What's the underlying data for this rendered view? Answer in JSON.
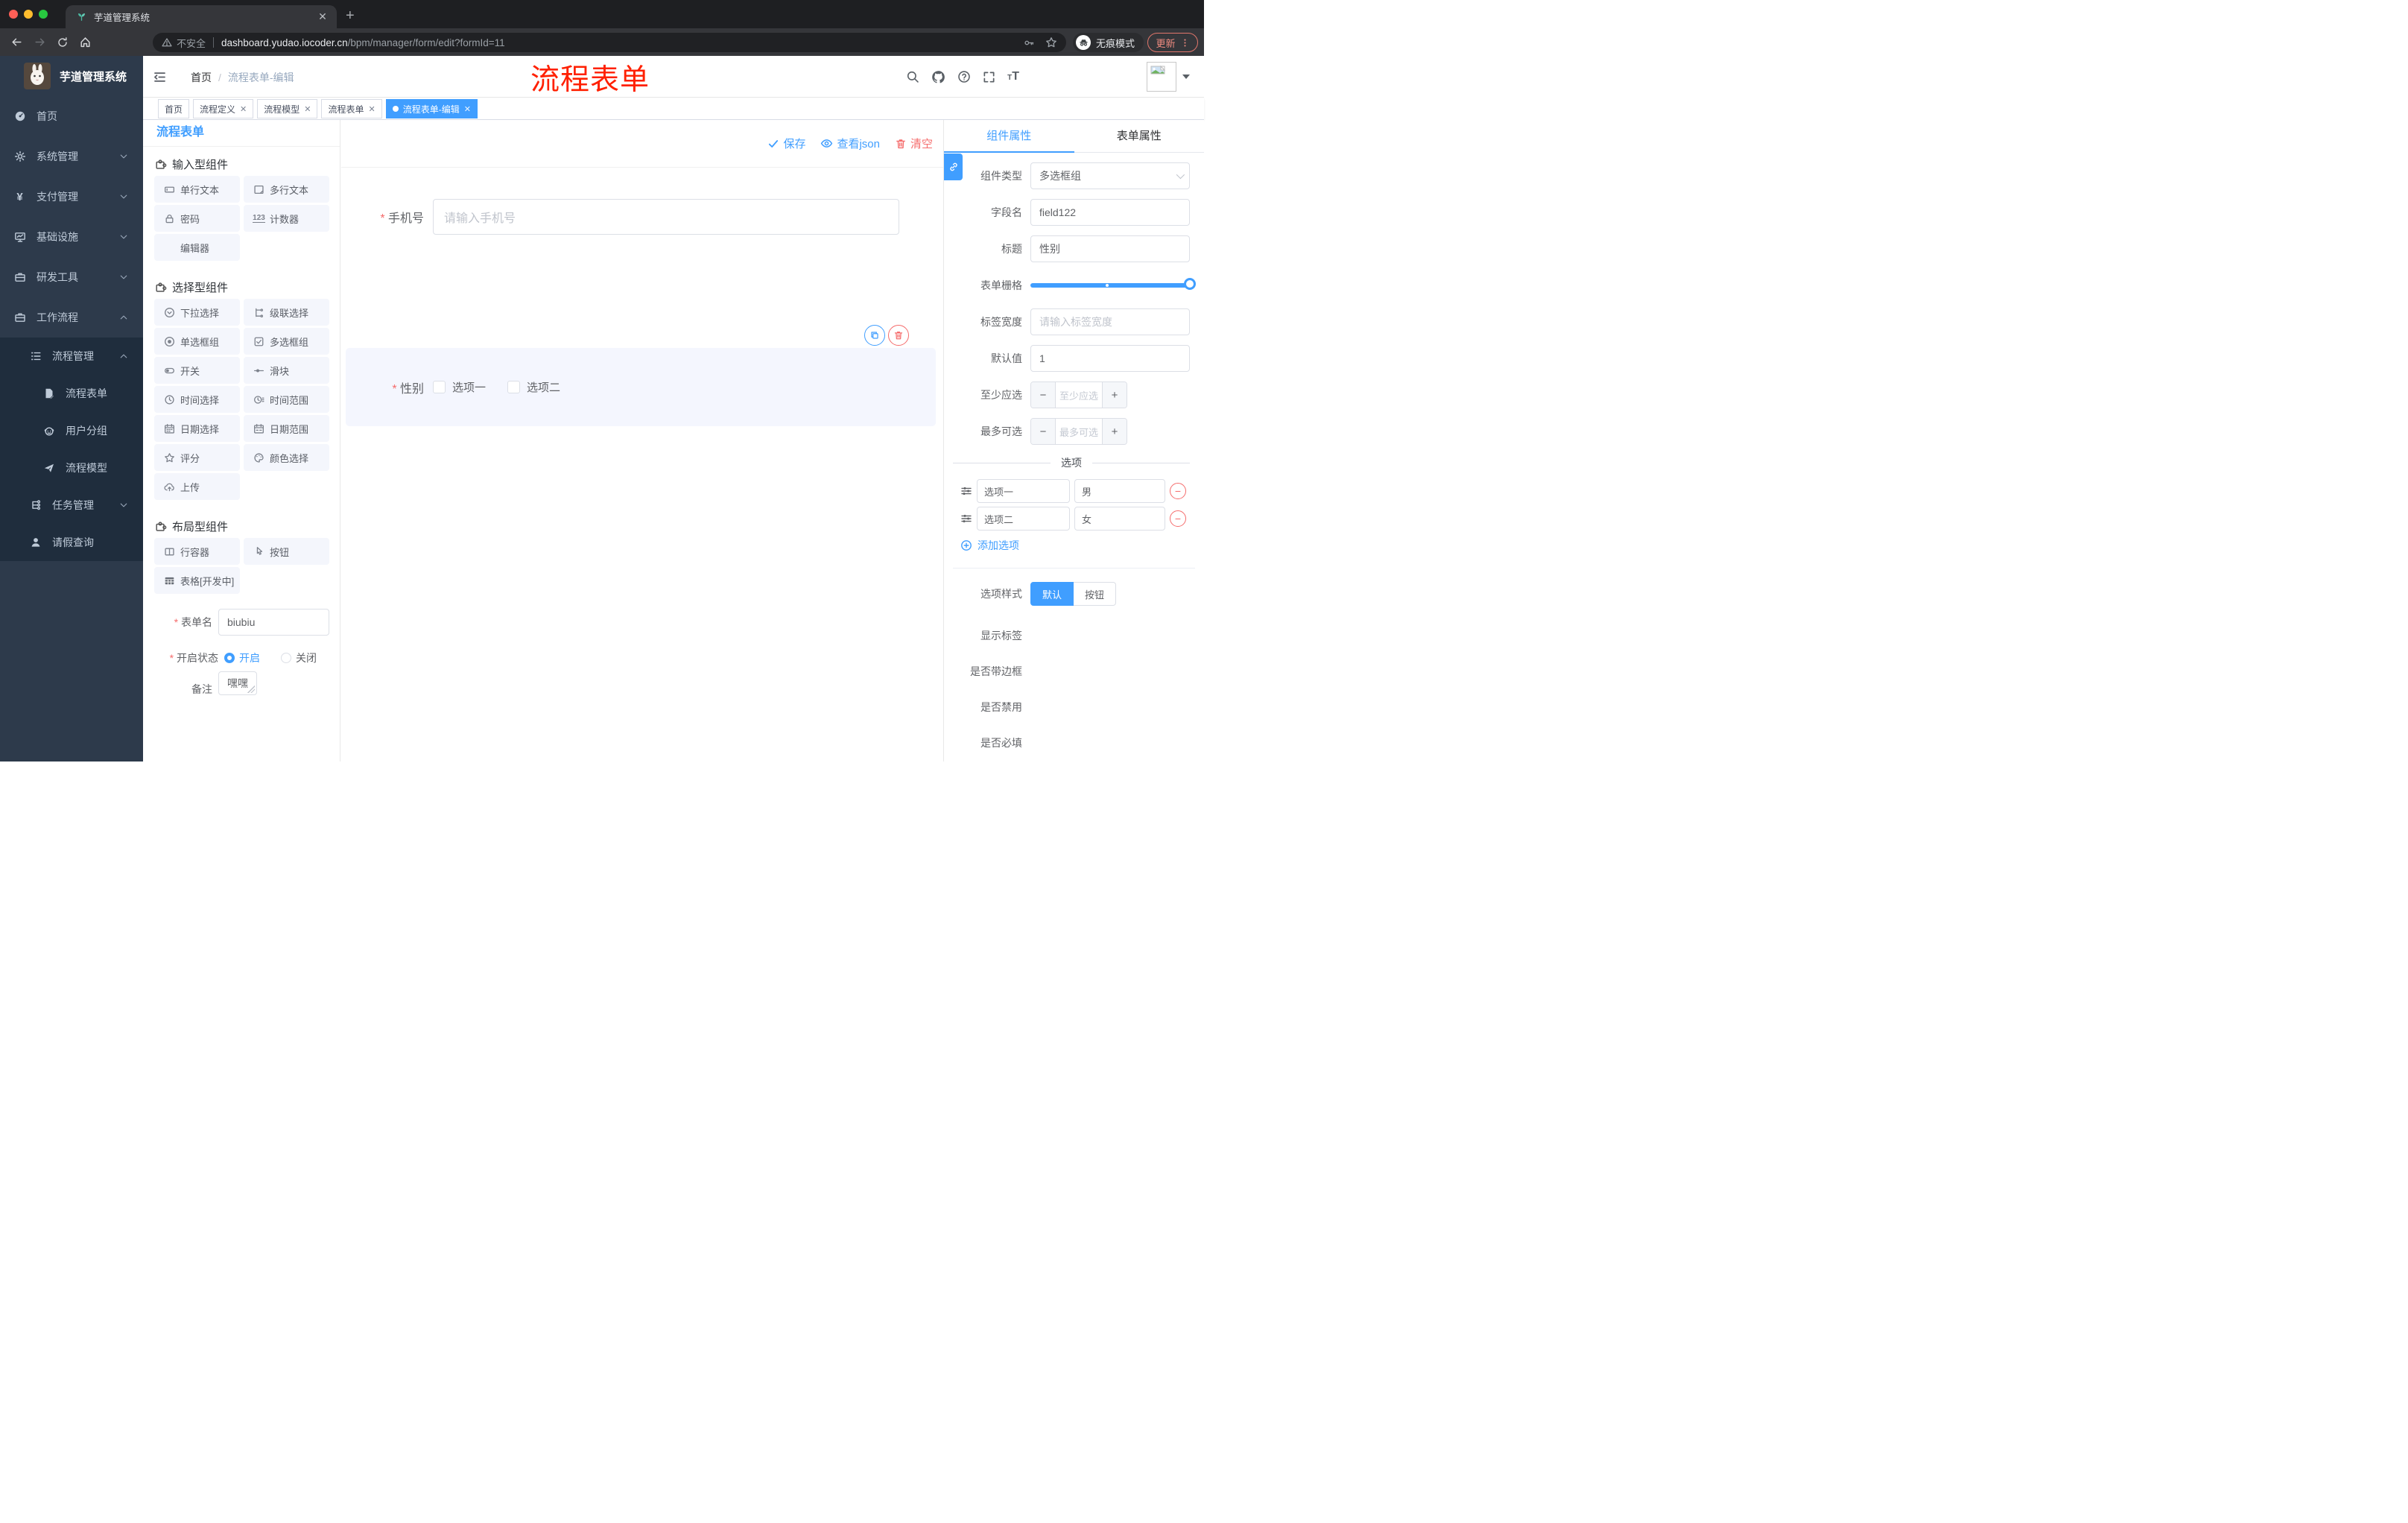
{
  "colors": {
    "accent": "#409eff",
    "danger": "#f56c6c",
    "annotation_red": "#ff2000",
    "sidebar_bg": "#2d3a4b",
    "submenu_bg": "#1f2d3d",
    "chip_bg": "#f4f6fc",
    "selected_bg": "#f4f6fe"
  },
  "browser": {
    "tab_title": "芋道管理系统",
    "tab_close": "✕",
    "not_secure": "不安全",
    "url_host": "dashboard.yudao.iocoder.cn",
    "url_path": "/bpm/manager/form/edit?formId=11",
    "incognito_label": "无痕模式",
    "update_label": "更新"
  },
  "sidebar": {
    "logo_title": "芋道管理系统",
    "items": [
      {
        "label": "首页",
        "icon": "dashboard",
        "level": 0,
        "chevron": "",
        "dark": false
      },
      {
        "label": "系统管理",
        "icon": "gear",
        "level": 0,
        "chevron": "down",
        "dark": false
      },
      {
        "label": "支付管理",
        "icon": "yen",
        "level": 0,
        "chevron": "down",
        "dark": false
      },
      {
        "label": "基础设施",
        "icon": "monitor",
        "level": 0,
        "chevron": "down",
        "dark": false
      },
      {
        "label": "研发工具",
        "icon": "briefcase",
        "level": 0,
        "chevron": "down",
        "dark": false
      },
      {
        "label": "工作流程",
        "icon": "briefcase",
        "level": 0,
        "chevron": "up",
        "dark": false
      },
      {
        "label": "流程管理",
        "icon": "flow-list",
        "level": 1,
        "chevron": "up",
        "dark": true
      },
      {
        "label": "流程表单",
        "icon": "doc-edit",
        "level": 2,
        "chevron": "",
        "dark": true
      },
      {
        "label": "用户分组",
        "icon": "robot",
        "level": 2,
        "chevron": "",
        "dark": true
      },
      {
        "label": "流程模型",
        "icon": "paper-plane",
        "level": 2,
        "chevron": "",
        "dark": true
      },
      {
        "label": "任务管理",
        "icon": "org-tree",
        "level": 1,
        "chevron": "down",
        "dark": true
      },
      {
        "label": "请假查询",
        "icon": "user",
        "level": 1,
        "chevron": "",
        "dark": true
      }
    ]
  },
  "header": {
    "breadcrumb_home": "首页",
    "breadcrumb_sep": "/",
    "breadcrumb_current": "流程表单-编辑",
    "annotation": "流程表单"
  },
  "tags": [
    {
      "label": "首页",
      "closable": false,
      "active": false
    },
    {
      "label": "流程定义",
      "closable": true,
      "active": false
    },
    {
      "label": "流程模型",
      "closable": true,
      "active": false
    },
    {
      "label": "流程表单",
      "closable": true,
      "active": false
    },
    {
      "label": "流程表单-编辑",
      "closable": true,
      "active": true
    }
  ],
  "left_panel": {
    "title": "流程表单",
    "sections": [
      {
        "title": "输入型组件",
        "items": [
          {
            "label": "单行文本",
            "icon": "text-field"
          },
          {
            "label": "多行文本",
            "icon": "textarea"
          },
          {
            "label": "密码",
            "icon": "lock"
          },
          {
            "label": "计数器",
            "icon": "counter"
          },
          {
            "label": "编辑器",
            "icon": "none"
          }
        ]
      },
      {
        "title": "选择型组件",
        "items": [
          {
            "label": "下拉选择",
            "icon": "select"
          },
          {
            "label": "级联选择",
            "icon": "cascade"
          },
          {
            "label": "单选框组",
            "icon": "radio"
          },
          {
            "label": "多选框组",
            "icon": "checkbox"
          },
          {
            "label": "开关",
            "icon": "switch"
          },
          {
            "label": "滑块",
            "icon": "slider"
          },
          {
            "label": "时间选择",
            "icon": "time"
          },
          {
            "label": "时间范围",
            "icon": "time-range"
          },
          {
            "label": "日期选择",
            "icon": "date"
          },
          {
            "label": "日期范围",
            "icon": "date-range"
          },
          {
            "label": "评分",
            "icon": "star"
          },
          {
            "label": "颜色选择",
            "icon": "palette"
          },
          {
            "label": "上传",
            "icon": "upload"
          }
        ]
      },
      {
        "title": "布局型组件",
        "items": [
          {
            "label": "行容器",
            "icon": "columns"
          },
          {
            "label": "按钮",
            "icon": "pointer"
          },
          {
            "label": "表格[开发中]",
            "icon": "table"
          }
        ]
      }
    ],
    "form": {
      "name_label": "表单名",
      "name_value": "biubiu",
      "status_label": "开启状态",
      "status_on": "开启",
      "status_off": "关闭",
      "remark_label": "备注",
      "remark_value": "嘿嘿"
    }
  },
  "canvas": {
    "save_label": "保存",
    "view_json_label": "查看json",
    "clear_label": "清空",
    "phone": {
      "label": "手机号",
      "placeholder": "请输入手机号",
      "required": true
    },
    "gender": {
      "label": "性别",
      "required": true,
      "options": [
        "选项一",
        "选项二"
      ]
    }
  },
  "right_panel": {
    "tab_component": "组件属性",
    "tab_form": "表单属性",
    "fields": {
      "type_label": "组件类型",
      "type_value": "多选框组",
      "field_label": "字段名",
      "field_value": "field122",
      "title_label": "标题",
      "title_value": "性别",
      "grid_label": "表单栅格",
      "width_label": "标签宽度",
      "width_placeholder": "请输入标签宽度",
      "default_label": "默认值",
      "default_value": "1",
      "min_label": "至少应选",
      "min_placeholder": "至少应选",
      "max_label": "最多可选",
      "max_placeholder": "最多可选"
    },
    "options_divider": "选项",
    "options": [
      {
        "name": "选项一",
        "value": "男"
      },
      {
        "name": "选项二",
        "value": "女"
      }
    ],
    "add_option": "添加选项",
    "style_label": "选项样式",
    "style_default": "默认",
    "style_button": "按钮",
    "toggles": [
      {
        "label": "显示标签",
        "on": true
      },
      {
        "label": "是否带边框",
        "on": false
      },
      {
        "label": "是否禁用",
        "on": false
      },
      {
        "label": "是否必填",
        "on": true
      }
    ]
  }
}
